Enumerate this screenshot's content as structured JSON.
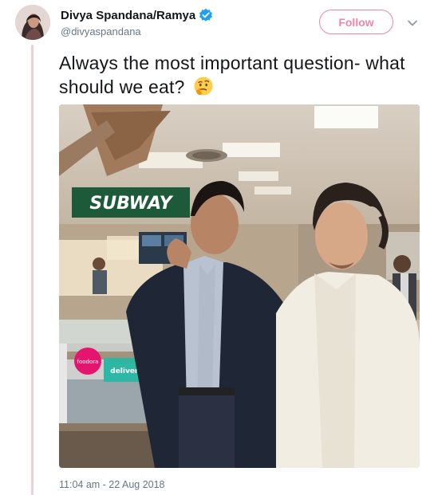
{
  "tweet": {
    "display_name": "Divya Spandana/Ramya",
    "handle": "@divyaspandana",
    "follow_label": "Follow",
    "text": "Always the most important question- what should we eat?",
    "emoji": "thinking-face",
    "timestamp": "11:04 am - 22 Aug 2018",
    "photo": {
      "store_sign": "SUBWAY",
      "counter_badge": "foodora",
      "counter_sign": "deliveroo"
    }
  },
  "colors": {
    "follow_accent": "#e0245e",
    "thread_line": "#f3cdd6",
    "verified_blue": "#1da1f2",
    "muted_text": "#657786",
    "subway_green": "#1d5a3a"
  }
}
